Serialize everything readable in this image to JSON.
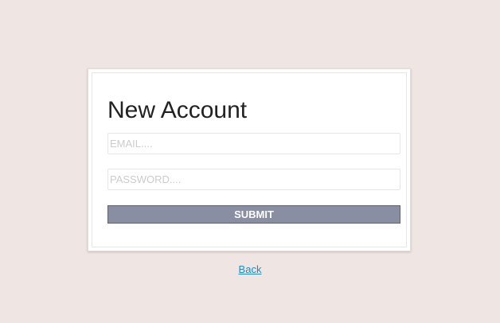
{
  "form": {
    "title": "New Account",
    "email_placeholder": "EMAIL....",
    "email_value": "",
    "password_placeholder": "PASSWORD....",
    "password_value": "",
    "submit_label": "SUBMIT"
  },
  "footer": {
    "back_label": "Back"
  },
  "colors": {
    "page_background": "#efe5e2",
    "submit_background": "#8a8ea2",
    "link": "#1a8ccc"
  }
}
